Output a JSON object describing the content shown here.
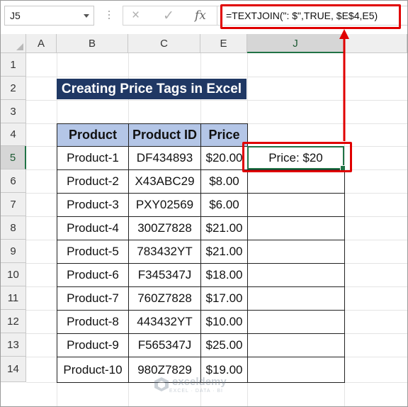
{
  "name_box": "J5",
  "formula_bar": {
    "cancel_icon": "×",
    "enter_icon": "✓",
    "fx_label": "fx",
    "formula": "=TEXTJOIN(\": $\",TRUE, $E$4,E5)"
  },
  "columns": [
    "A",
    "B",
    "C",
    "E",
    "J"
  ],
  "rows": [
    "1",
    "2",
    "3",
    "4",
    "5",
    "6",
    "7",
    "8",
    "9",
    "10",
    "11",
    "12",
    "13",
    "14"
  ],
  "title": "Creating Price Tags in Excel",
  "table": {
    "headers": [
      "Product",
      "Product ID",
      "Price"
    ],
    "rows": [
      [
        "Product-1",
        "DF434893",
        "$20.00"
      ],
      [
        "Product-2",
        "X43ABC29",
        "$8.00"
      ],
      [
        "Product-3",
        "PXY02569",
        "$6.00"
      ],
      [
        "Product-4",
        "300Z7828",
        "$21.00"
      ],
      [
        "Product-5",
        "783432YT",
        "$21.00"
      ],
      [
        "Product-6",
        "F345347J",
        "$18.00"
      ],
      [
        "Product-7",
        "760Z7828",
        "$17.00"
      ],
      [
        "Product-8",
        "443432YT",
        "$10.00"
      ],
      [
        "Product-9",
        "F565347J",
        "$25.00"
      ],
      [
        "Product-10",
        "980Z7829",
        "$19.00"
      ]
    ]
  },
  "result_cell": "Price: $20",
  "watermark": {
    "name": "exceldemy",
    "sub": "EXCEL · DATA · BI"
  },
  "colors": {
    "accent": "#217346",
    "title_bg": "#203864",
    "header_bg": "#b4c6e7",
    "annotation": "#e00000"
  }
}
